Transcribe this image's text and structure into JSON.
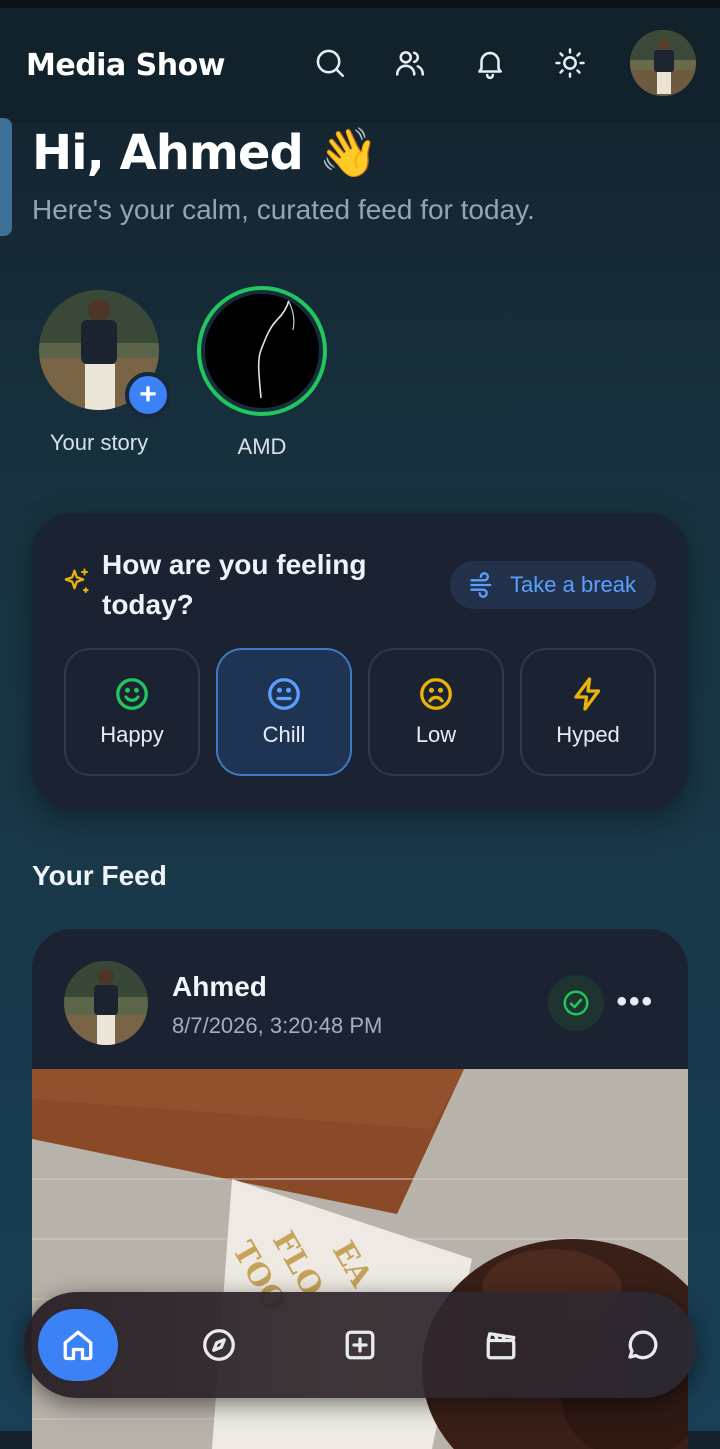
{
  "header": {
    "brand": "Media Show",
    "icons": [
      "search-icon",
      "people-icon",
      "bell-icon",
      "sun-icon"
    ]
  },
  "greeting": {
    "title": "Hi, Ahmed 👋",
    "subtitle": "Here's your calm, curated feed for today."
  },
  "stories": [
    {
      "label": "Your story",
      "add_icon": "plus-icon"
    },
    {
      "label": "AMD"
    }
  ],
  "mood": {
    "title": "How are you feeling today?",
    "break_label": "Take a break",
    "options": [
      {
        "label": "Happy",
        "icon": "smile-icon",
        "color": "#22c55e"
      },
      {
        "label": "Chill",
        "icon": "neutral-face-icon",
        "color": "#5aa1ff",
        "selected": true
      },
      {
        "label": "Low",
        "icon": "frown-icon",
        "color": "#eab308"
      },
      {
        "label": "Hyped",
        "icon": "lightning-icon",
        "color": "#eab308"
      }
    ]
  },
  "feed": {
    "title": "Your Feed",
    "post": {
      "author": "Ahmed",
      "timestamp": "8/7/2026, 3:20:48 PM",
      "more_label": "•••"
    }
  },
  "nav": {
    "items": [
      "home-icon",
      "compass-icon",
      "add-square-icon",
      "clapperboard-icon",
      "chat-icon"
    ],
    "active": "home-icon"
  },
  "colors": {
    "accent": "#3b82f6",
    "story_ring": "#22c55e",
    "verified": "#22c55e"
  }
}
